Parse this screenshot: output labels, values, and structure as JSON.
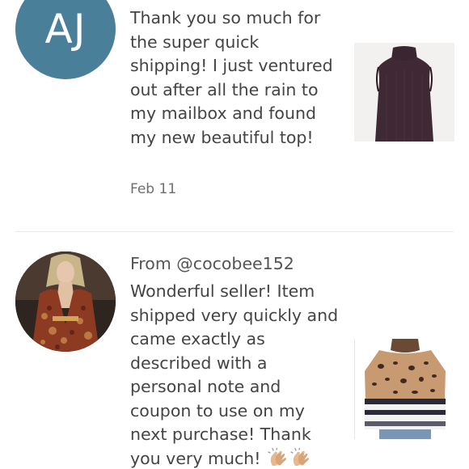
{
  "reviews": [
    {
      "avatar_initials": "AJ",
      "avatar_color": "#4a7f9a",
      "text": "Thank you so much for the super quick shipping! I just ventured out after all the rain to my mailbox and found my new beautiful top!",
      "date": "Feb 11",
      "item_icon": "sleeveless-mock-neck-top-photo"
    },
    {
      "from": "From @cocobee152",
      "avatar_icon": "runway-model-photo",
      "text": "Wonderful seller! Item shipped very quickly and came exactly as described with a personal note and coupon to use on my next purchase! Thank you very much!",
      "reaction_icons": [
        "clapping-hands-icon",
        "clapping-hands-icon"
      ],
      "item_icon": "leopard-striped-sweater-photo"
    }
  ]
}
